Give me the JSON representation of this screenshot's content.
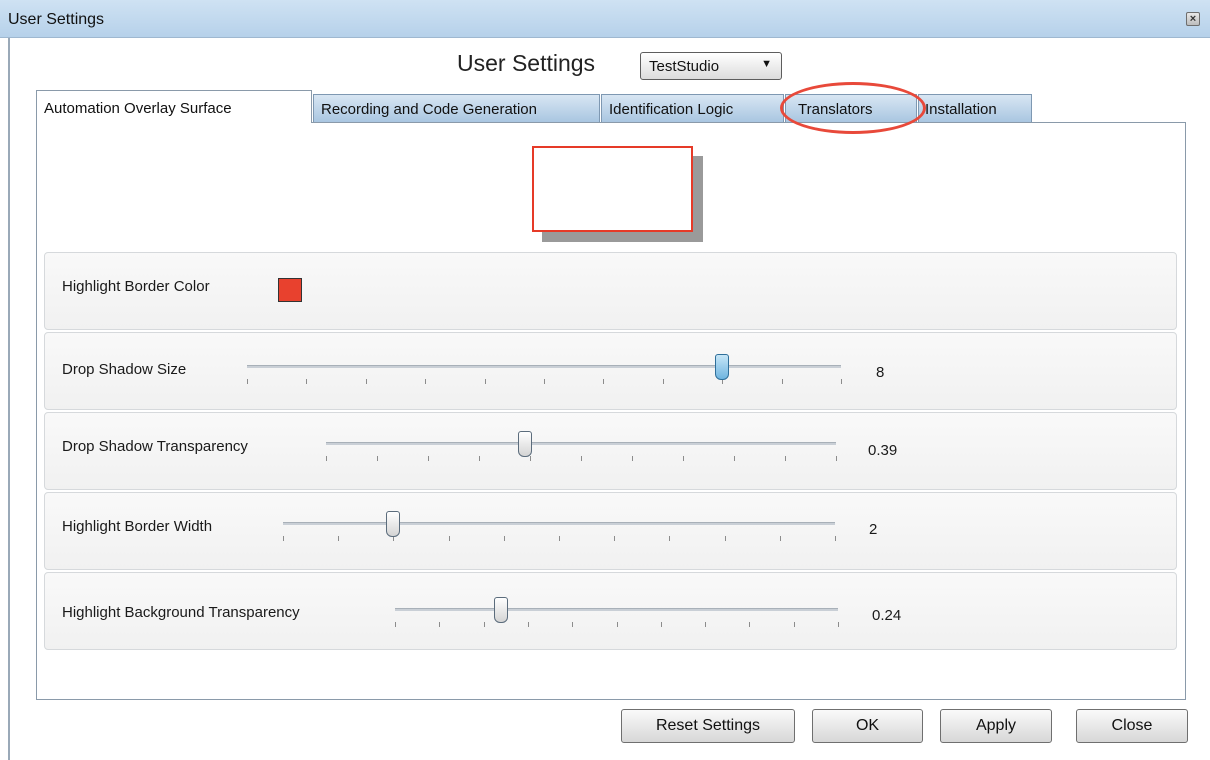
{
  "window": {
    "title": "User Settings",
    "close_glyph": "×"
  },
  "header": {
    "title": "User Settings",
    "profile_value": "TestStudio"
  },
  "tabs": [
    {
      "label": "Automation Overlay Surface",
      "active": true
    },
    {
      "label": "Recording and Code Generation",
      "active": false
    },
    {
      "label": "Identification Logic",
      "active": false
    },
    {
      "label": "Translators",
      "active": false,
      "circled": true
    },
    {
      "label": "Installation",
      "active": false
    }
  ],
  "settings": {
    "border_color": {
      "label": "Highlight Border Color",
      "color": "#e8412e"
    },
    "shadow_size": {
      "label": "Drop Shadow Size",
      "value": "8",
      "fraction": 0.8
    },
    "shadow_transparency": {
      "label": "Drop Shadow Transparency",
      "value": "0.39",
      "fraction": 0.39
    },
    "border_width": {
      "label": "Highlight Border Width",
      "value": "2",
      "fraction": 0.2
    },
    "background_transparency": {
      "label": "Highlight Background Transparency",
      "value": "0.24",
      "fraction": 0.24
    }
  },
  "footer": {
    "reset_label": "Reset Settings",
    "ok_label": "OK",
    "apply_label": "Apply",
    "close_label": "Close"
  },
  "colors": {
    "accent": "#e8493a",
    "tab_fill": "#a9c6e1",
    "preview_border": "#e63a28"
  }
}
